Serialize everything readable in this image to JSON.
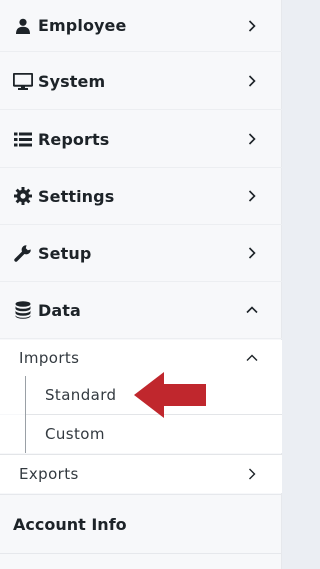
{
  "menu": {
    "items": [
      {
        "label": "Employee",
        "icon": "user-icon",
        "state": "collapsed"
      },
      {
        "label": "System",
        "icon": "monitor-icon",
        "state": "collapsed"
      },
      {
        "label": "Reports",
        "icon": "list-icon",
        "state": "collapsed"
      },
      {
        "label": "Settings",
        "icon": "gear-icon",
        "state": "collapsed"
      },
      {
        "label": "Setup",
        "icon": "wrench-icon",
        "state": "collapsed"
      },
      {
        "label": "Data",
        "icon": "database-icon",
        "state": "expanded"
      }
    ],
    "data_submenu": {
      "imports": {
        "label": "Imports",
        "state": "expanded",
        "children": [
          {
            "label": "Standard"
          },
          {
            "label": "Custom"
          }
        ]
      },
      "exports": {
        "label": "Exports",
        "state": "collapsed"
      }
    },
    "account": {
      "label": "Account Info"
    }
  },
  "colors": {
    "pointer_arrow": "#c0272d",
    "text": "#1d2328",
    "sidebar_bg": "#f7f8fa"
  }
}
